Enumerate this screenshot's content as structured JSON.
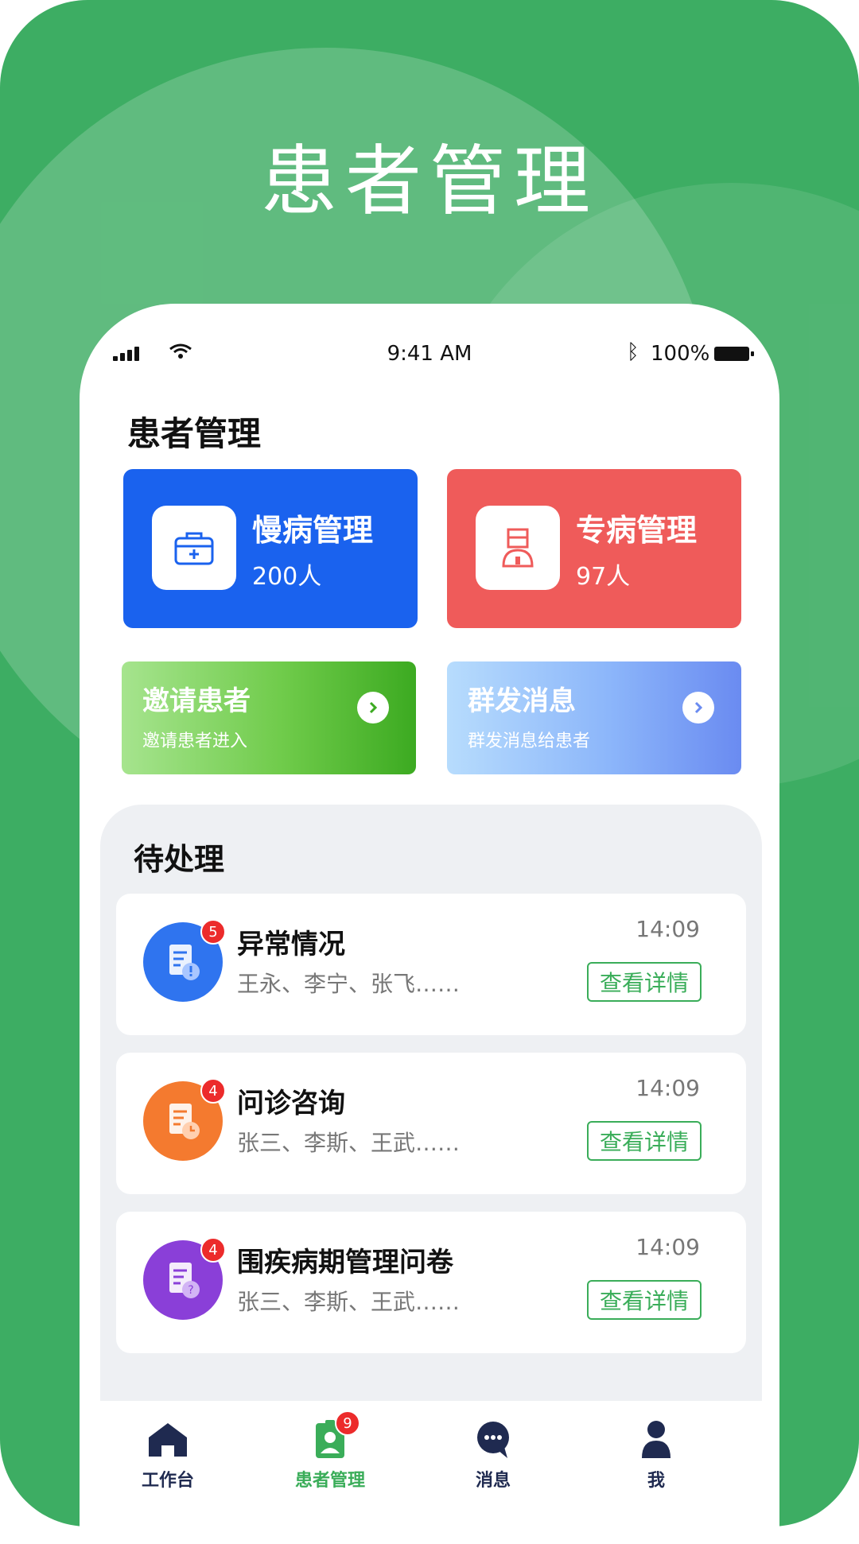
{
  "hero": {
    "title": "患者管理"
  },
  "status_bar": {
    "time": "9:41 AM",
    "battery": "100%"
  },
  "page": {
    "title": "患者管理"
  },
  "cards": [
    {
      "title": "慢病管理",
      "count": "200人",
      "icon": "medical-kit-icon"
    },
    {
      "title": "专病管理",
      "count": "97人",
      "icon": "patient-icon"
    }
  ],
  "actions": [
    {
      "title": "邀请患者",
      "subtitle": "邀请患者进入"
    },
    {
      "title": "群发消息",
      "subtitle": "群发消息给患者"
    }
  ],
  "pending": {
    "title": "待处理",
    "button_label": "查看详情",
    "items": [
      {
        "title": "异常情况",
        "names": "王永、李宁、张飞……",
        "time": "14:09",
        "badge": "5",
        "color": "#2f74ef",
        "icon": "alert-document-icon"
      },
      {
        "title": "问诊咨询",
        "names": "张三、李斯、王武……",
        "time": "14:09",
        "badge": "4",
        "color": "#f47a2f",
        "icon": "clock-document-icon"
      },
      {
        "title": "围疾病期管理问卷",
        "names": "张三、李斯、王武……",
        "time": "14:09",
        "badge": "4",
        "color": "#8a3fd8",
        "icon": "question-document-icon"
      }
    ]
  },
  "tabs": [
    {
      "label": "工作台",
      "icon": "home-icon"
    },
    {
      "label": "患者管理",
      "icon": "patient-badge-icon",
      "badge": "9"
    },
    {
      "label": "消息",
      "icon": "message-icon"
    },
    {
      "label": "我",
      "icon": "user-icon"
    }
  ]
}
